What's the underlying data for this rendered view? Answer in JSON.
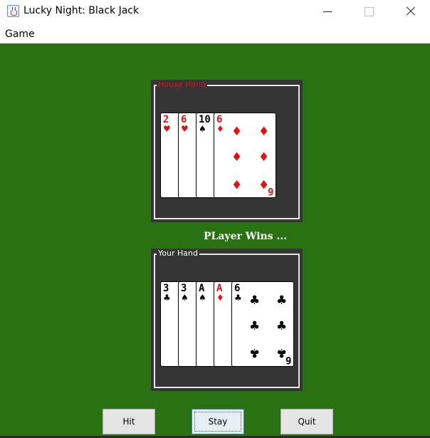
{
  "window": {
    "title": "Lucky Night: Black Jack",
    "icon": "java-cup-icon"
  },
  "menu": {
    "items": [
      "Game"
    ]
  },
  "colors": {
    "felt": "#2a7114",
    "panel": "#353535",
    "house_label": "#e21010",
    "player_label": "#ffffff"
  },
  "house": {
    "label": "House Hand",
    "cards": [
      {
        "rank": "2",
        "suit": "hearts",
        "suit_symbol": "♥",
        "color": "red"
      },
      {
        "rank": "6",
        "suit": "hearts",
        "suit_symbol": "♥",
        "color": "red"
      },
      {
        "rank": "10",
        "suit": "spades",
        "suit_symbol": "♠",
        "color": "black"
      },
      {
        "rank": "6",
        "suit": "diamonds",
        "suit_symbol": "♦",
        "color": "red"
      }
    ]
  },
  "status": "PLayer Wins ...",
  "player": {
    "label": "Your Hand",
    "cards": [
      {
        "rank": "3",
        "suit": "clubs",
        "suit_symbol": "♣",
        "color": "black"
      },
      {
        "rank": "3",
        "suit": "spades",
        "suit_symbol": "♠",
        "color": "black"
      },
      {
        "rank": "A",
        "suit": "spades",
        "suit_symbol": "♠",
        "color": "black"
      },
      {
        "rank": "A",
        "suit": "diamonds",
        "suit_symbol": "♦",
        "color": "red"
      },
      {
        "rank": "6",
        "suit": "clubs",
        "suit_symbol": "♣",
        "color": "black"
      }
    ]
  },
  "buttons": {
    "hit": "Hit",
    "stay": "Stay",
    "quit": "Quit"
  }
}
